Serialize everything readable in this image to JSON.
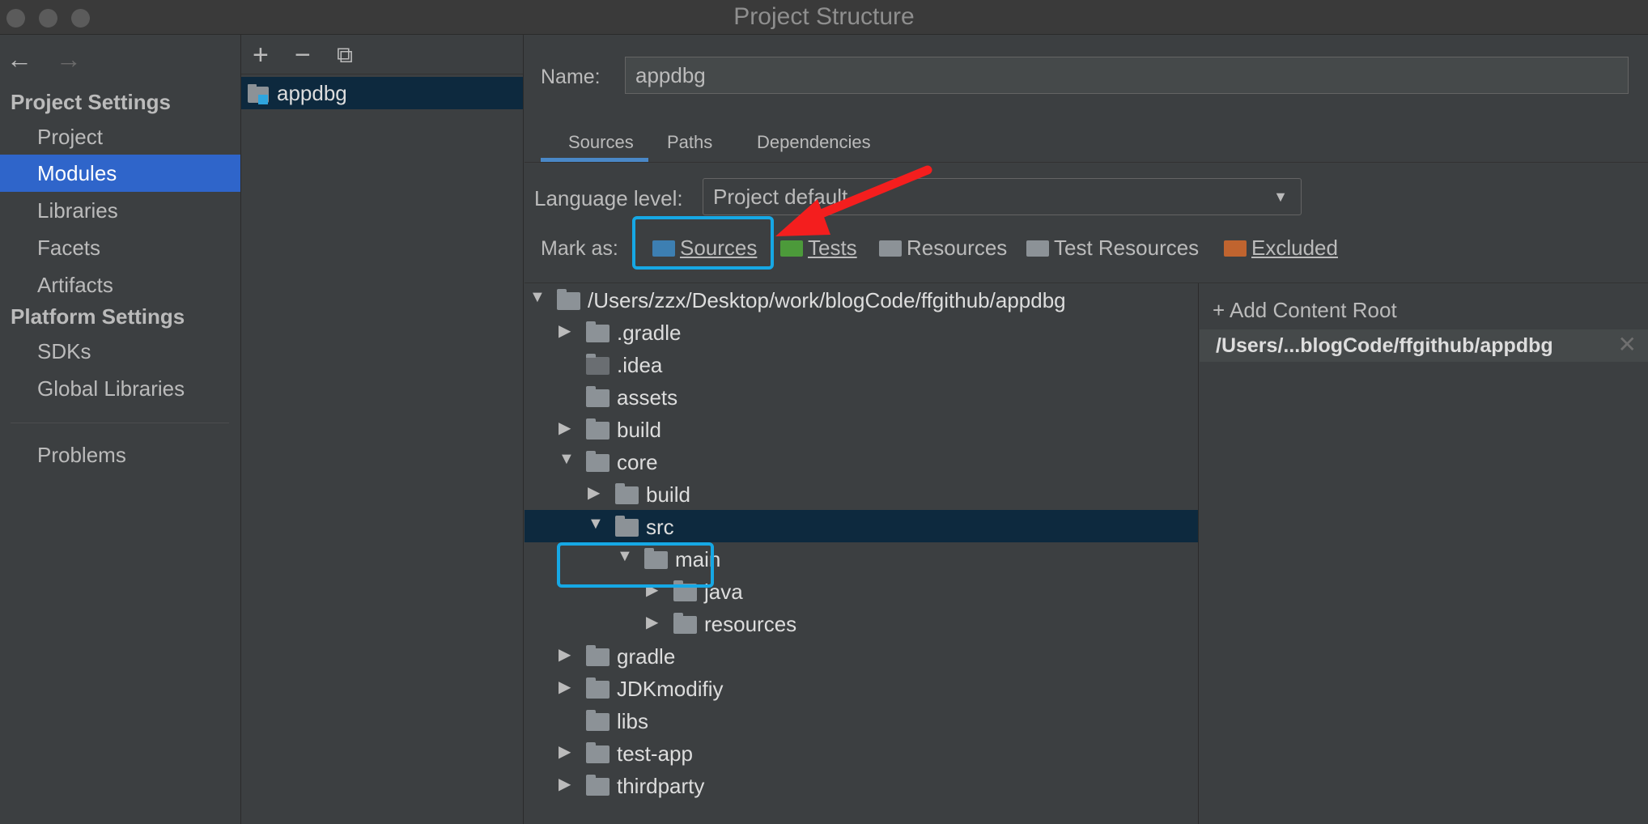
{
  "window": {
    "title": "Project Structure"
  },
  "nav": {
    "back_icon": "←",
    "forward_icon": "→",
    "project_settings": "Project Settings",
    "project_items": [
      "Project",
      "Modules",
      "Libraries",
      "Facets",
      "Artifacts"
    ],
    "selected": "Modules",
    "platform_settings": "Platform Settings",
    "platform_items": [
      "SDKs",
      "Global Libraries"
    ],
    "problems": "Problems"
  },
  "modules": {
    "toolbar": {
      "add": "+",
      "remove": "−",
      "copy": "⧉"
    },
    "items": [
      {
        "label": "appdbg"
      }
    ]
  },
  "main": {
    "name_label": "Name:",
    "name_value": "appdbg",
    "tabs": [
      "Sources",
      "Paths",
      "Dependencies"
    ],
    "active_tab": "Sources",
    "language_level_label": "Language level:",
    "language_level_value": "Project default",
    "mark_as_label": "Mark as:",
    "mark_as": {
      "sources": "Sources",
      "tests": "Tests",
      "resources": "Resources",
      "test_resources": "Test Resources",
      "excluded": "Excluded"
    },
    "mark_colors": {
      "sources": "#3d7fb2",
      "tests": "#4c9a3a",
      "resources": "#8c9297",
      "test_resources": "#8c9297",
      "excluded": "#c0642f"
    },
    "tree": [
      {
        "label": "/Users/zzx/Desktop/work/blogCode/ffgithub/appdbg",
        "arrow": "▼"
      },
      {
        "label": ".gradle",
        "arrow": "▶"
      },
      {
        "label": ".idea",
        "arrow": ""
      },
      {
        "label": "assets",
        "arrow": ""
      },
      {
        "label": "build",
        "arrow": "▶"
      },
      {
        "label": "core",
        "arrow": "▼"
      },
      {
        "label": "build",
        "arrow": "▶"
      },
      {
        "label": "src",
        "arrow": "▼"
      },
      {
        "label": "main",
        "arrow": "▼"
      },
      {
        "label": "java",
        "arrow": "▶"
      },
      {
        "label": "resources",
        "arrow": "▶"
      },
      {
        "label": "gradle",
        "arrow": "▶"
      },
      {
        "label": "JDKmodifiy",
        "arrow": "▶"
      },
      {
        "label": "libs",
        "arrow": ""
      },
      {
        "label": "test-app",
        "arrow": "▶"
      },
      {
        "label": "thirdparty",
        "arrow": "▶"
      }
    ],
    "selected_tree_item": "src",
    "content_roots": {
      "add_label": "+ Add Content Root",
      "path": "/Users/...blogCode/ffgithub/appdbg",
      "close_icon": "✕"
    }
  },
  "accent_colors": {
    "highlight_box": "#16a8e5",
    "annotation_arrow": "#f41e1e",
    "selection": "#2f65ca"
  }
}
